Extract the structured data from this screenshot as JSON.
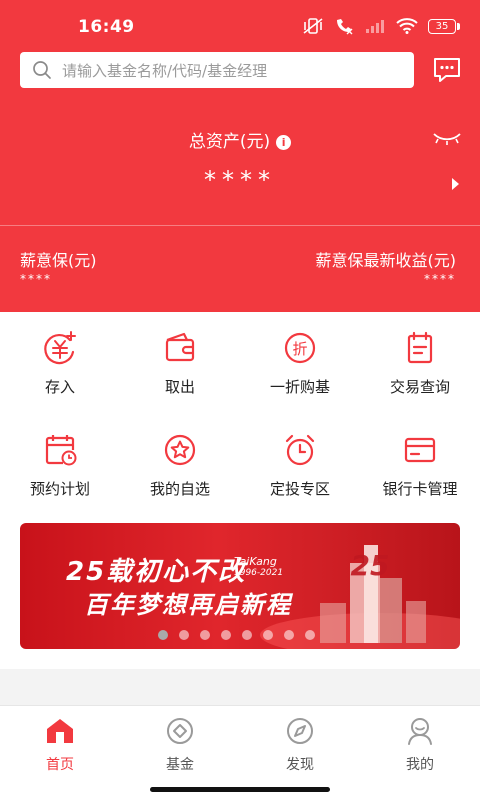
{
  "status_bar": {
    "time": "16:49",
    "battery": "35"
  },
  "search": {
    "placeholder": "请输入基金名称/代码/基金经理"
  },
  "assets": {
    "title": "总资产(元)",
    "value": "****",
    "info_icon": "info-icon",
    "eye_icon": "eye-closed-icon"
  },
  "salary": {
    "left_label": "薪意保(元)",
    "left_value": "****",
    "right_label": "薪意保最新收益(元)",
    "right_value": "****"
  },
  "quick_actions": [
    {
      "label": "存入",
      "icon": "deposit-yen-icon"
    },
    {
      "label": "取出",
      "icon": "wallet-icon"
    },
    {
      "label": "一折购基",
      "icon": "discount-icon"
    },
    {
      "label": "交易查询",
      "icon": "document-icon"
    },
    {
      "label": "预约计划",
      "icon": "calendar-clock-icon"
    },
    {
      "label": "我的自选",
      "icon": "star-icon"
    },
    {
      "label": "定投专区",
      "icon": "alarm-clock-icon"
    },
    {
      "label": "银行卡管理",
      "icon": "bank-card-icon"
    }
  ],
  "banner": {
    "line1": "25载初心不改",
    "line2": "百年梦想再启新程",
    "brand": "TaiKang",
    "years": "1996-2021",
    "slide_count": 8,
    "active_slide": 1
  },
  "tabs": [
    {
      "label": "首页",
      "icon": "home-icon",
      "active": true
    },
    {
      "label": "基金",
      "icon": "fund-icon",
      "active": false
    },
    {
      "label": "发现",
      "icon": "compass-icon",
      "active": false
    },
    {
      "label": "我的",
      "icon": "profile-icon",
      "active": false
    }
  ],
  "colors": {
    "brand_red": "#f2393f",
    "tab_inactive": "#9a9a9a"
  }
}
